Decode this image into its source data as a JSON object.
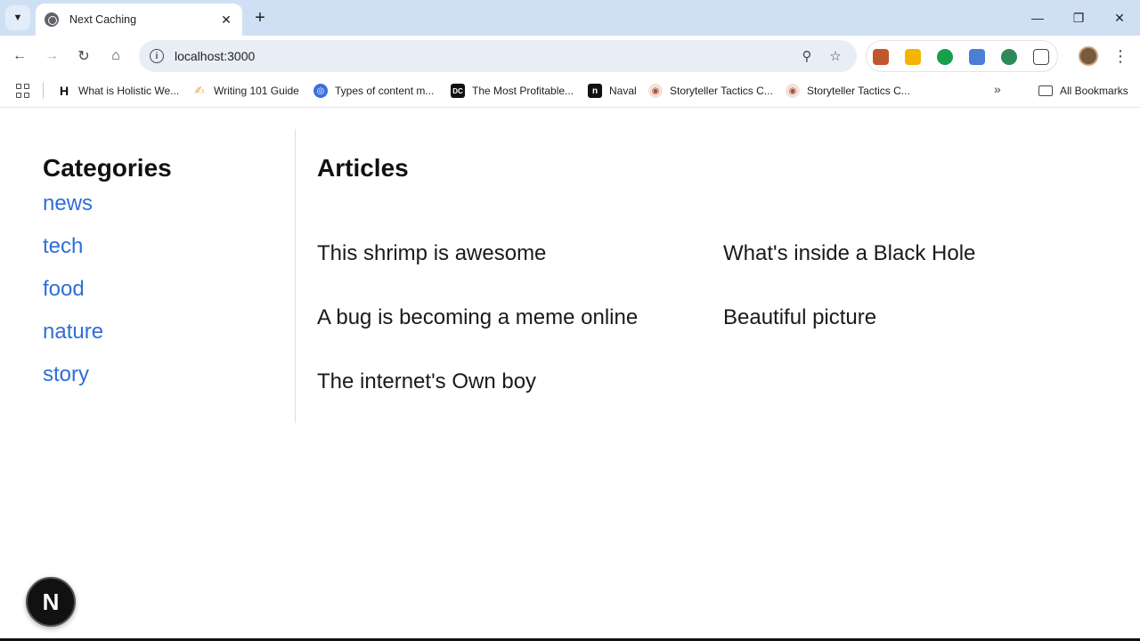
{
  "browser": {
    "tab_title": "Next Caching",
    "tab_close": "✕",
    "new_tab": "+",
    "url": "localhost:3000",
    "window": {
      "minimize": "—",
      "restore": "❐",
      "close": "✕"
    }
  },
  "bookmarks": {
    "items": [
      {
        "label": "What is Holistic We...",
        "icon": "H",
        "icon_color": "#000000",
        "icon_bg": "#ffffff"
      },
      {
        "label": "Writing 101 Guide",
        "icon": "✍",
        "icon_color": "#e8a33d",
        "icon_bg": "#ffffff"
      },
      {
        "label": "Types of content m...",
        "icon": "◎",
        "icon_color": "#ffffff",
        "icon_bg": "#3b6fe0"
      },
      {
        "label": "The Most Profitable...",
        "icon": "DC",
        "icon_color": "#ffffff",
        "icon_bg": "#111111"
      },
      {
        "label": "Naval",
        "icon": "n",
        "icon_color": "#ffffff",
        "icon_bg": "#111111"
      },
      {
        "label": "Storyteller Tactics C...",
        "icon": "◉",
        "icon_color": "#b04a3a",
        "icon_bg": "#f3e2d8"
      },
      {
        "label": "Storyteller Tactics C...",
        "icon": "◉",
        "icon_color": "#b04a3a",
        "icon_bg": "#f3e2d8"
      }
    ],
    "more": "»",
    "all_label": "All Bookmarks"
  },
  "sidebar": {
    "title": "Categories",
    "categories": [
      "news",
      "tech",
      "food",
      "nature",
      "story"
    ]
  },
  "main": {
    "title": "Articles",
    "articles": [
      "This shrimp is awesome",
      "What's inside a Black Hole",
      "A bug is becoming a meme online",
      "Beautiful picture",
      "The internet's Own boy"
    ]
  },
  "badge": {
    "letter": "N"
  },
  "colors": {
    "link": "#2f6fd6",
    "tabstrip": "#cfe0f4"
  }
}
